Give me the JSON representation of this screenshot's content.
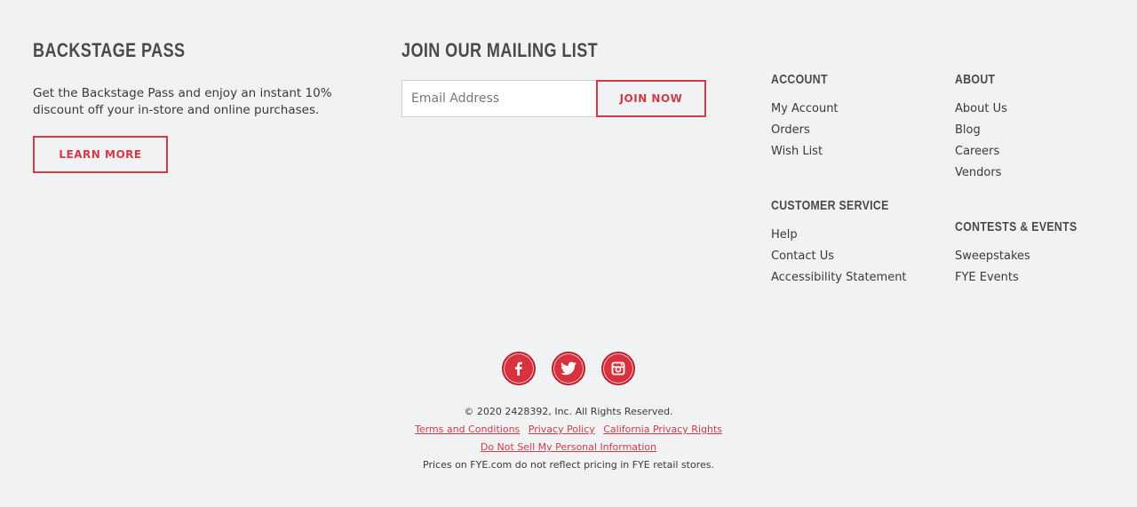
{
  "backstage": {
    "title": "BACKSTAGE PASS",
    "description": "Get the Backstage Pass and enjoy an instant 10% discount off your in-store and online purchases.",
    "button_label": "LEARN MORE"
  },
  "mailing": {
    "title": "JOIN OUR MAILING LIST",
    "email_placeholder": "Email Address",
    "email_value": "",
    "button_label": "JOIN NOW"
  },
  "account": {
    "title": "ACCOUNT",
    "links": [
      "My Account",
      "Orders",
      "Wish List"
    ]
  },
  "customer_service": {
    "title": "CUSTOMER SERVICE",
    "links": [
      "Help",
      "Contact Us",
      "Accessibility Statement"
    ]
  },
  "about": {
    "title": "ABOUT",
    "links": [
      "About Us",
      "Blog",
      "Careers",
      "Vendors"
    ]
  },
  "contests": {
    "title": "CONTESTS & EVENTS",
    "links": [
      "Sweepstakes",
      "FYE Events"
    ]
  },
  "social": {
    "icons": [
      "facebook-icon",
      "twitter-icon",
      "instagram-icon"
    ],
    "color": "#d8323f"
  },
  "legal": {
    "copyright": "© 2020 2428392, Inc. All Rights Reserved.",
    "links": [
      "Terms and Conditions",
      "Privacy Policy",
      "California Privacy Rights"
    ],
    "do_not_sell": "Do Not Sell My Personal Information",
    "pricing_note": "Prices on FYE.com do not reflect pricing in FYE retail stores."
  },
  "colors": {
    "accent": "#d23a47",
    "background": "#f1f2f4",
    "text": "#3a3a3a"
  }
}
